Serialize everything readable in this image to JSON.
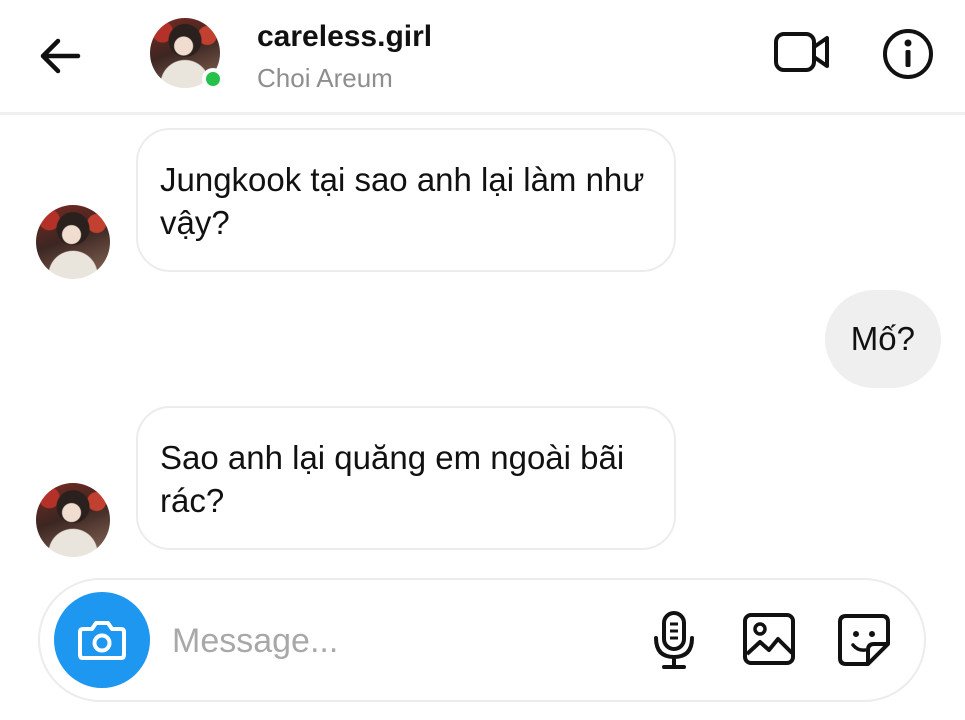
{
  "header": {
    "username": "careless.girl",
    "subtitle": "Choi Areum",
    "back_icon": "arrow-left-icon",
    "video_icon": "video-camera-icon",
    "info_icon": "info-icon",
    "online_color": "#26c14a"
  },
  "messages": [
    {
      "direction": "incoming",
      "text": "Jungkook tại sao anh lại làm như vậy?"
    },
    {
      "direction": "outgoing",
      "text": "Mố?"
    },
    {
      "direction": "incoming",
      "text": "Sao anh lại quăng em ngoài bãi rác?"
    }
  ],
  "composer": {
    "placeholder": "Message...",
    "value": "",
    "camera_icon": "camera-icon",
    "mic_icon": "microphone-icon",
    "gallery_icon": "gallery-icon",
    "sticker_icon": "sticker-icon",
    "accent_color": "#1e97f0"
  },
  "colors": {
    "outgoing_bubble": "#efefef",
    "incoming_border": "#ececec",
    "subtitle_text": "#8e8e8e"
  }
}
